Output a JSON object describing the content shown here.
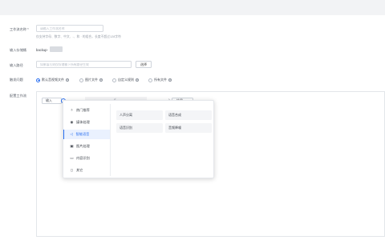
{
  "form": {
    "name_label": "工作流名称 *",
    "name_placeholder": "请输入工作流名称",
    "name_hint": "仅支持字母、数字、中文、-、和 · 的组合，长度不超过128字符",
    "input_bucket_label": "输入存储桶",
    "input_bucket_value": "backup-",
    "input_path_label": "输入路径",
    "input_path_placeholder": "如果填写则仅存储桶下所有路径生效",
    "select_button": "选择",
    "trigger_label": "触发问题",
    "trigger_options": [
      {
        "label": "默认音视频文件",
        "selected": true
      },
      {
        "label": "图片文件",
        "selected": false
      },
      {
        "label": "自定义规则",
        "selected": false
      },
      {
        "label": "所有文件",
        "selected": false
      }
    ],
    "config_label": "配置工作流"
  },
  "flow": {
    "input_node": "输入",
    "output_node": "结果"
  },
  "menu": {
    "categories": [
      {
        "label": "热门推荐",
        "icon": "fire-icon"
      },
      {
        "label": "媒体处理",
        "icon": "media-icon"
      },
      {
        "label": "智能语音",
        "icon": "speaker-icon"
      },
      {
        "label": "图片处理",
        "icon": "image-icon"
      },
      {
        "label": "内容识别",
        "icon": "video-icon"
      },
      {
        "label": "其它",
        "icon": "document-icon"
      }
    ],
    "active_index": 2,
    "options": [
      "人声分离",
      "语音合成",
      "语音识别",
      "音频降噪"
    ]
  },
  "colors": {
    "accent": "#2a6ff0",
    "background": "#f2f3f5"
  }
}
